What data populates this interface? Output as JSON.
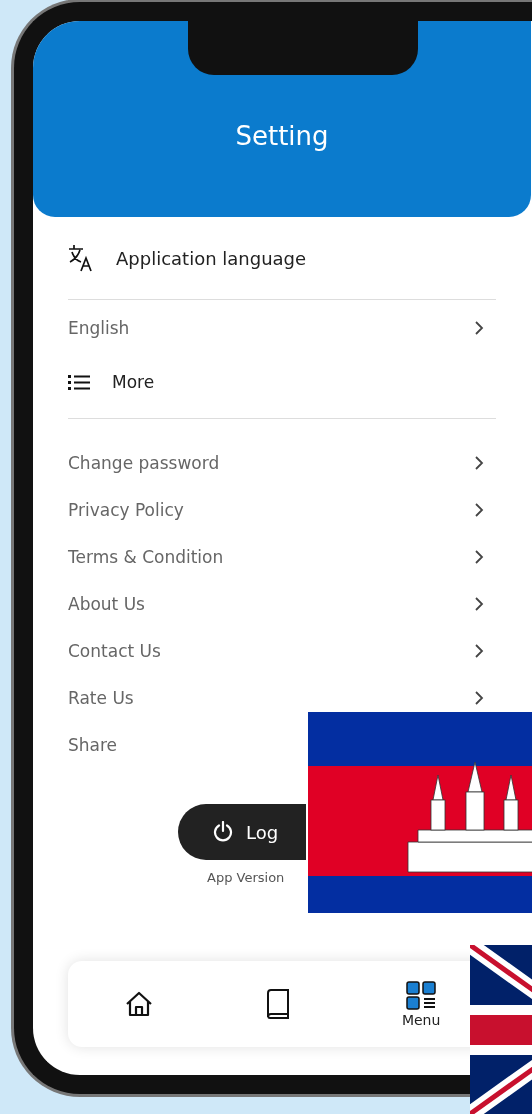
{
  "header": {
    "title": "Setting"
  },
  "language_section": {
    "title": "Application language",
    "value": "English"
  },
  "more_section": {
    "title": "More"
  },
  "menu_items": [
    {
      "label": "Change password"
    },
    {
      "label": "Privacy Policy"
    },
    {
      "label": "Terms & Condition"
    },
    {
      "label": "About Us"
    },
    {
      "label": "Contact Us"
    },
    {
      "label": "Rate Us"
    },
    {
      "label": "Share"
    }
  ],
  "logout_button": {
    "label": "Log"
  },
  "app_version": "App Version",
  "bottom_nav": [
    {
      "kind": "home",
      "selected": false
    },
    {
      "kind": "book",
      "selected": false
    },
    {
      "kind": "menu",
      "label": "Menu",
      "selected": true
    }
  ]
}
